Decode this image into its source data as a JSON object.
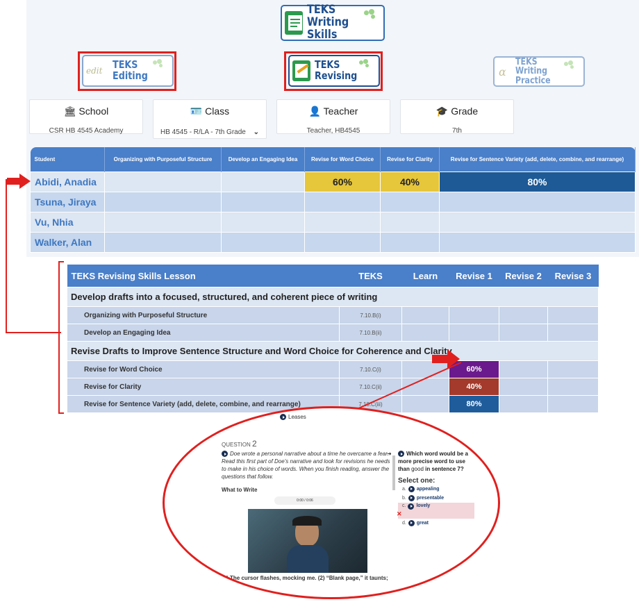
{
  "logos": {
    "main": {
      "line1": "TEKS",
      "line2": "Writing Skills"
    },
    "editing": {
      "mark": "edit",
      "line1": "TEKS",
      "line2": "Editing"
    },
    "revising": {
      "line1": "TEKS",
      "line2": "Revising"
    },
    "practice": {
      "mark": "α",
      "line1": "TEKS",
      "line2": "Writing Practice"
    }
  },
  "info": {
    "school": {
      "label": "School",
      "value": "CSR HB 4545 Academy"
    },
    "class": {
      "label": "Class",
      "value": "HB 4545 - R/LA - 7th Grade"
    },
    "teacher": {
      "label": "Teacher",
      "value": "Teacher, HB4545"
    },
    "grade": {
      "label": "Grade",
      "value": "7th"
    }
  },
  "student_table": {
    "headers": [
      "Student",
      "Organizing with Purposeful Structure",
      "Develop an Engaging Idea",
      "Revise for Word Choice",
      "Revise for Clarity",
      "Revise for Sentence Variety (add, delete, combine, and rearrange)"
    ],
    "rows": [
      {
        "name": "Abidi, Anadia",
        "scores": [
          "",
          "",
          "60%",
          "40%",
          "80%"
        ]
      },
      {
        "name": "Tsuna, Jiraya",
        "scores": [
          "",
          "",
          "",
          "",
          ""
        ]
      },
      {
        "name": "Vu, Nhia",
        "scores": [
          "",
          "",
          "",
          "",
          ""
        ]
      },
      {
        "name": "Walker, Alan",
        "scores": [
          "",
          "",
          "",
          "",
          ""
        ]
      }
    ]
  },
  "lesson_table": {
    "headers": [
      "TEKS Revising Skills Lesson",
      "TEKS",
      "Learn",
      "Revise 1",
      "Revise 2",
      "Revise 3"
    ],
    "section1": "Develop drafts into a focused, structured, and coherent piece of writing",
    "section1_items": [
      {
        "name": "Organizing with Purposeful Structure",
        "code": "7.10.B(i)",
        "revise1": ""
      },
      {
        "name": "Develop an Engaging Idea",
        "code": "7.10.B(ii)",
        "revise1": ""
      }
    ],
    "section2": "Revise Drafts to Improve Sentence Structure and Word Choice for Coherence and Clarity",
    "section2_items": [
      {
        "name": "Revise for Word Choice",
        "code": "7.10.C(i)",
        "revise1": "60%"
      },
      {
        "name": "Revise for Clarity",
        "code": "7.10.C(ii)",
        "revise1": "40%"
      },
      {
        "name": "Revise for Sentence Variety (add, delete, combine, and rearrange)",
        "code": "7.10.C(iii)",
        "revise1": "80%"
      }
    ]
  },
  "colors": {
    "header_blue": "#4a7fc9",
    "score_yellow": "#e6c63a",
    "score_dark_blue": "#1d5a96",
    "lesson_purple": "#6a1a8c",
    "lesson_red": "#a33a2b",
    "lesson_blue": "#1f5c9c",
    "highlight_red": "#e0201e"
  },
  "quiz": {
    "top_fragment": "Leases",
    "question_label": "QUESTION",
    "question_number": "2",
    "passage_intro": "Doe wrote a personal narrative about a time he overcame a fear. Read this first part of Doe's narrative and look for revisions he needs to make in his choice of words. When you finish reading, answer the questions that follow.",
    "what_to_write": "What to Write",
    "audio_time": "0:00 / 0:06",
    "passage_text": "(1) The cursor flashes, mocking me. (2) “Blank page,” it taunts;",
    "question_prefix": "Which word would be a more precise word to use than ",
    "question_word": "good",
    "question_suffix": " in sentence 7?",
    "select_label": "Select one:",
    "options": [
      {
        "letter": "a.",
        "text": "appealing"
      },
      {
        "letter": "b.",
        "text": "presentable"
      },
      {
        "letter": "c.",
        "text": "lovely"
      },
      {
        "letter": "d.",
        "text": "great"
      }
    ]
  }
}
